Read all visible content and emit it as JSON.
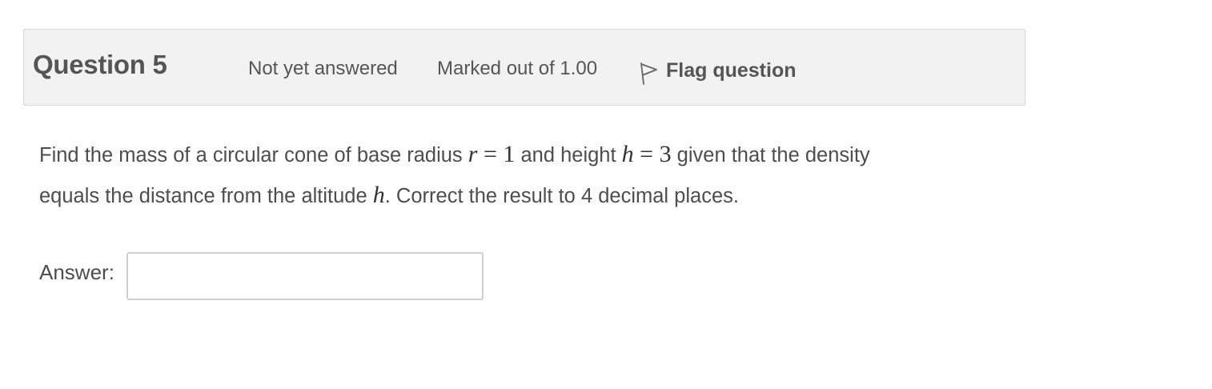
{
  "info": {
    "question_title": "Question 5",
    "state": "Not yet answered",
    "grade": "Marked out of 1.00",
    "flag_label": "Flag question",
    "flag_icon": "flag-icon"
  },
  "question": {
    "text_1": "Find the mass of a circular cone of base radius ",
    "math_r_var": "r",
    "math_r_eq": " = 1",
    "text_2": " and height ",
    "math_h_var": "h",
    "math_h_eq": " = 3",
    "text_3": " given that the density",
    "text_4": "equals the distance from the altitude ",
    "math_h2_var": "h",
    "text_5": ". Correct the result to 4 decimal places."
  },
  "answer": {
    "label": "Answer:",
    "value": ""
  }
}
